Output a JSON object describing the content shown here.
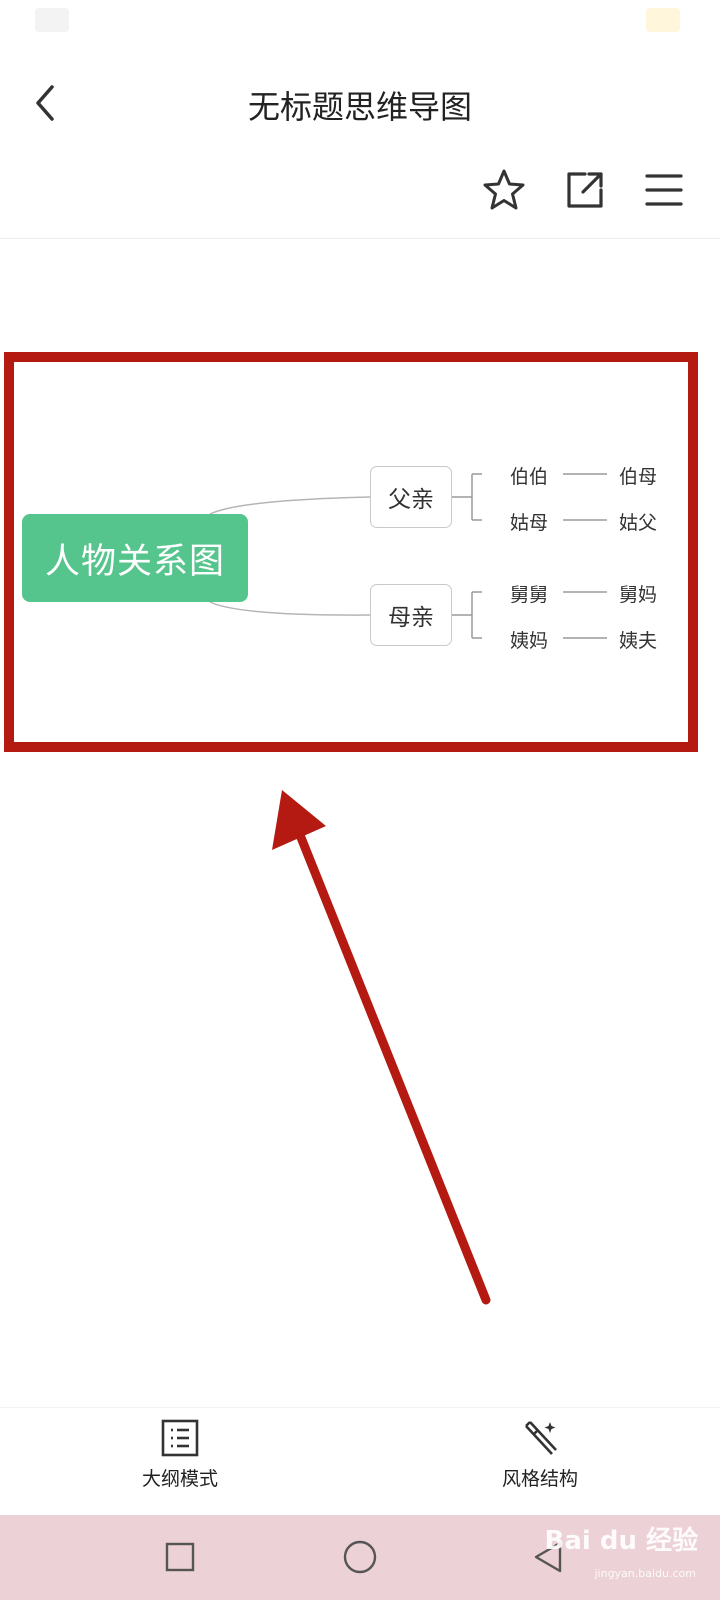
{
  "header": {
    "title": "无标题思维导图"
  },
  "mindmap": {
    "root": "人物关系图",
    "branches": [
      {
        "label": "父亲",
        "rows": [
          [
            "伯伯",
            "伯母"
          ],
          [
            "姑母",
            "姑父"
          ]
        ]
      },
      {
        "label": "母亲",
        "rows": [
          [
            "舅舅",
            "舅妈"
          ],
          [
            "姨妈",
            "姨夫"
          ]
        ]
      }
    ]
  },
  "bottom_bar": {
    "outline_label": "大纲模式",
    "style_label": "风格结构"
  },
  "watermark": {
    "brand": "Bai du 经验",
    "url": "jingyan.baidu.com"
  },
  "colors": {
    "root_node": "#55c48d",
    "highlight": "#b41a12",
    "navbar": "#ecd1d6"
  },
  "icons": [
    "back-icon",
    "star-icon",
    "share-icon",
    "menu-icon",
    "outline-icon",
    "magic-wand-icon",
    "square-icon",
    "circle-icon",
    "triangle-back-icon"
  ]
}
